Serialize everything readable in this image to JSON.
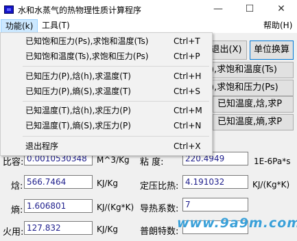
{
  "window": {
    "title": "水和水蒸气的热物理性质计算程序",
    "minimize": "—",
    "maximize": "☐",
    "close": "✕"
  },
  "menubar": {
    "function": "功能(k)",
    "tools": "工具(T)",
    "help": "帮助(H)"
  },
  "toolbar": {
    "exit": "退出(X)",
    "unit_convert": "单位换算"
  },
  "right_buttons": [
    "),求饱和温度(Ts)",
    "),求饱和压力(Ps)",
    "已知温度,焓,求P",
    "已知温度,熵,求P"
  ],
  "dropdown": {
    "items": [
      {
        "label": "已知饱和压力(Ps),求饱和温度(Ts)",
        "shortcut": "Ctrl+T"
      },
      {
        "label": "已知饱和温度(Ts),求饱和压力(Ps)",
        "shortcut": "Ctrl+P"
      },
      {
        "label": "已知压力(P),焓(h),求温度(T)",
        "shortcut": "Ctrl+H"
      },
      {
        "label": "已知压力(P),熵(S),求温度(T)",
        "shortcut": "Ctrl+S"
      },
      {
        "label": "已知温度(T),焓(h),求压力(P)",
        "shortcut": "Ctrl+M"
      },
      {
        "label": "已知温度(T),熵(S),求压力(P)",
        "shortcut": "Ctrl+N"
      },
      {
        "label": "退出程序",
        "shortcut": "Ctrl+X"
      }
    ]
  },
  "results": {
    "specific_volume": {
      "label": "比容:",
      "value": "0.0010530348",
      "unit": "M^3/Kg"
    },
    "enthalpy": {
      "label": "焓:",
      "value": "566.7464",
      "unit": "KJ/Kg"
    },
    "entropy": {
      "label": "熵:",
      "value": "1.606801",
      "unit": "KJ/(Kg*K)"
    },
    "exergy": {
      "label": "火用:",
      "value": "127.832",
      "unit": "KJ/Kg"
    },
    "viscosity": {
      "label": "粘    度:",
      "value": "220.4949",
      "unit": "1E-6Pa*s"
    },
    "cp": {
      "label": "定压比热:",
      "value": "4.191032",
      "unit": "KJ/(Kg*K)"
    },
    "conductivity": {
      "label": "导热系数:",
      "value": "7",
      "unit": ""
    },
    "prandtl": {
      "label": "普朗特数:",
      "value": "",
      "unit": ""
    }
  },
  "watermark": "www.9a9m.com"
}
